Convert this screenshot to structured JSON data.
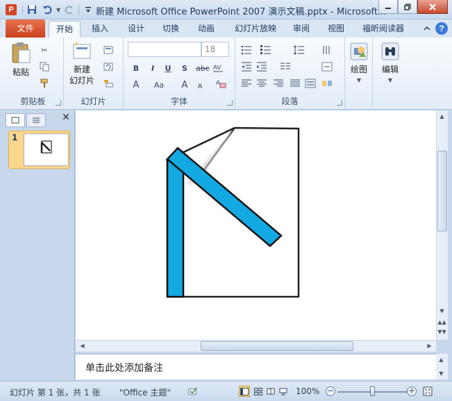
{
  "window": {
    "title": "新建 Microsoft Office PowerPoint 2007 演示文稿.pptx - Microsoft...",
    "app_icon_letter": "P"
  },
  "ribbon_tabs": {
    "file": "文件",
    "items": [
      "开始",
      "插入",
      "设计",
      "切换",
      "动画",
      "幻灯片放映",
      "审阅",
      "视图",
      "福昕阅读器"
    ],
    "active": "开始"
  },
  "clipboard": {
    "paste": "粘贴",
    "label": "剪贴板"
  },
  "slides_group": {
    "new_slide_line1": "新建",
    "new_slide_line2": "幻灯片",
    "label": "幻灯片"
  },
  "font_group": {
    "font_name": "",
    "font_size": "18",
    "label": "字体",
    "bold": "B",
    "italic": "I",
    "underline": "U",
    "shadow": "S",
    "strike": "abc",
    "grow": "A",
    "shrink": "A",
    "font_color": "A",
    "case": "Aa"
  },
  "paragraph_group": {
    "label": "段落"
  },
  "drawing_group": {
    "label": "绘图"
  },
  "editing_group": {
    "label": "编辑"
  },
  "slide_pane": {
    "thumb_number": "1"
  },
  "notes": {
    "placeholder": "单击此处添加备注"
  },
  "status": {
    "slide_info": "幻灯片 第 1 张，共 1 张",
    "theme": "\"Office 主题\"",
    "zoom": "100%"
  },
  "colors": {
    "accent_blue": "#13a9e2",
    "file_tab": "#c8411b",
    "highlight": "#fbd88e"
  }
}
